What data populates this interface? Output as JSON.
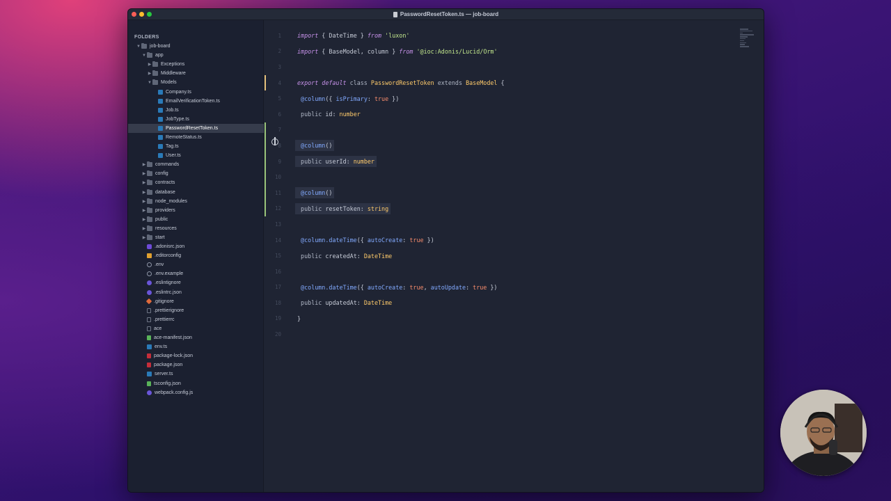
{
  "window": {
    "title": "PasswordResetToken.ts — job-board"
  },
  "sidebar": {
    "header": "FOLDERS",
    "items": [
      {
        "label": "job-board",
        "depth": 0,
        "kind": "folder",
        "open": true
      },
      {
        "label": "app",
        "depth": 1,
        "kind": "folder",
        "open": true
      },
      {
        "label": "Exceptions",
        "depth": 2,
        "kind": "folder",
        "open": false
      },
      {
        "label": "Middleware",
        "depth": 2,
        "kind": "folder",
        "open": false
      },
      {
        "label": "Models",
        "depth": 2,
        "kind": "folder",
        "open": true
      },
      {
        "label": "Company.ts",
        "depth": 3,
        "kind": "ts"
      },
      {
        "label": "EmailVerificationToken.ts",
        "depth": 3,
        "kind": "ts"
      },
      {
        "label": "Job.ts",
        "depth": 3,
        "kind": "ts"
      },
      {
        "label": "JobType.ts",
        "depth": 3,
        "kind": "ts"
      },
      {
        "label": "PasswordResetToken.ts",
        "depth": 3,
        "kind": "ts",
        "selected": true
      },
      {
        "label": "RemoteStatus.ts",
        "depth": 3,
        "kind": "ts"
      },
      {
        "label": "Tag.ts",
        "depth": 3,
        "kind": "ts"
      },
      {
        "label": "User.ts",
        "depth": 3,
        "kind": "ts"
      },
      {
        "label": "commands",
        "depth": 1,
        "kind": "folder",
        "open": false
      },
      {
        "label": "config",
        "depth": 1,
        "kind": "folder",
        "open": false
      },
      {
        "label": "contracts",
        "depth": 1,
        "kind": "folder",
        "open": false
      },
      {
        "label": "database",
        "depth": 1,
        "kind": "folder",
        "open": false
      },
      {
        "label": "node_modules",
        "depth": 1,
        "kind": "folder",
        "open": false
      },
      {
        "label": "providers",
        "depth": 1,
        "kind": "folder",
        "open": false
      },
      {
        "label": "public",
        "depth": 1,
        "kind": "folder",
        "open": false
      },
      {
        "label": "resources",
        "depth": 1,
        "kind": "folder",
        "open": false
      },
      {
        "label": "start",
        "depth": 1,
        "kind": "folder",
        "open": false
      },
      {
        "label": ".adonisrc.json",
        "depth": 1,
        "kind": "adonis"
      },
      {
        "label": ".editorconfig",
        "depth": 1,
        "kind": "edcfg"
      },
      {
        "label": ".env",
        "depth": 1,
        "kind": "gear"
      },
      {
        "label": ".env.example",
        "depth": 1,
        "kind": "gear"
      },
      {
        "label": ".eslintignore",
        "depth": 1,
        "kind": "purple"
      },
      {
        "label": ".eslintrc.json",
        "depth": 1,
        "kind": "purple"
      },
      {
        "label": ".gitignore",
        "depth": 1,
        "kind": "orange"
      },
      {
        "label": ".prettierignore",
        "depth": 1,
        "kind": "blank"
      },
      {
        "label": ".prettierrc",
        "depth": 1,
        "kind": "blank"
      },
      {
        "label": "ace",
        "depth": 1,
        "kind": "blank"
      },
      {
        "label": "ace-manifest.json",
        "depth": 1,
        "kind": "json-g"
      },
      {
        "label": "env.ts",
        "depth": 1,
        "kind": "ts"
      },
      {
        "label": "package-lock.json",
        "depth": 1,
        "kind": "npm"
      },
      {
        "label": "package.json",
        "depth": 1,
        "kind": "npm"
      },
      {
        "label": "server.ts",
        "depth": 1,
        "kind": "ts"
      },
      {
        "label": "tsconfig.json",
        "depth": 1,
        "kind": "json-g"
      },
      {
        "label": "webpack.config.js",
        "depth": 1,
        "kind": "purple"
      }
    ]
  },
  "editor": {
    "lines": [
      {
        "n": "1",
        "mark": "",
        "hl": false,
        "tokens": [
          [
            "kw",
            "import"
          ],
          [
            "plain",
            " { "
          ],
          [
            "plain",
            "DateTime"
          ],
          [
            "plain",
            " } "
          ],
          [
            "kw",
            "from"
          ],
          [
            "plain",
            " "
          ],
          [
            "str",
            "'luxon'"
          ]
        ]
      },
      {
        "n": "2",
        "mark": "",
        "hl": false,
        "tokens": [
          [
            "kw",
            "import"
          ],
          [
            "plain",
            " { "
          ],
          [
            "plain",
            "BaseModel"
          ],
          [
            "plain",
            ", "
          ],
          [
            "plain",
            "column"
          ],
          [
            "plain",
            " } "
          ],
          [
            "kw",
            "from"
          ],
          [
            "plain",
            " "
          ],
          [
            "str",
            "'@ioc:Adonis/Lucid/Orm'"
          ]
        ]
      },
      {
        "n": "3",
        "mark": "",
        "hl": false,
        "tokens": []
      },
      {
        "n": "4",
        "mark": "mod",
        "hl": false,
        "tokens": [
          [
            "kw",
            "export default"
          ],
          [
            "plain",
            " "
          ],
          [
            "mod",
            "class"
          ],
          [
            "plain",
            " "
          ],
          [
            "cls",
            "PasswordResetToken"
          ],
          [
            "plain",
            " "
          ],
          [
            "mod",
            "extends"
          ],
          [
            "plain",
            " "
          ],
          [
            "cls",
            "BaseModel"
          ],
          [
            "plain",
            " {"
          ]
        ]
      },
      {
        "n": "5",
        "mark": "",
        "hl": false,
        "tokens": [
          [
            "plain",
            " "
          ],
          [
            "dec",
            "@column"
          ],
          [
            "plain",
            "({ "
          ],
          [
            "prop",
            "isPrimary"
          ],
          [
            "plain",
            ": "
          ],
          [
            "bool",
            "true"
          ],
          [
            "plain",
            " })"
          ]
        ]
      },
      {
        "n": "6",
        "mark": "",
        "hl": false,
        "tokens": [
          [
            "plain",
            " "
          ],
          [
            "mod",
            "public"
          ],
          [
            "plain",
            " "
          ],
          [
            "plain",
            "id"
          ],
          [
            "plain",
            ": "
          ],
          [
            "type",
            "number"
          ]
        ]
      },
      {
        "n": "7",
        "mark": "add",
        "hl": false,
        "tokens": []
      },
      {
        "n": "8",
        "mark": "add",
        "hl": true,
        "caret": true,
        "tokens": [
          [
            "plain",
            " "
          ],
          [
            "dec",
            "@column"
          ],
          [
            "plain",
            "()"
          ]
        ]
      },
      {
        "n": "9",
        "mark": "add",
        "hl": true,
        "tokens": [
          [
            "plain",
            " "
          ],
          [
            "mod",
            "public"
          ],
          [
            "plain",
            " "
          ],
          [
            "plain",
            "userId"
          ],
          [
            "plain",
            ": "
          ],
          [
            "type",
            "number"
          ]
        ]
      },
      {
        "n": "10",
        "mark": "add",
        "hl": true,
        "tokens": []
      },
      {
        "n": "11",
        "mark": "add",
        "hl": true,
        "tokens": [
          [
            "plain",
            " "
          ],
          [
            "dec",
            "@column"
          ],
          [
            "plain",
            "()"
          ]
        ]
      },
      {
        "n": "12",
        "mark": "add",
        "hl": true,
        "tokens": [
          [
            "plain",
            " "
          ],
          [
            "mod",
            "public"
          ],
          [
            "plain",
            " "
          ],
          [
            "plain",
            "resetToken"
          ],
          [
            "plain",
            ": "
          ],
          [
            "type",
            "string"
          ]
        ]
      },
      {
        "n": "13",
        "mark": "",
        "hl": false,
        "tokens": []
      },
      {
        "n": "14",
        "mark": "",
        "hl": false,
        "tokens": [
          [
            "plain",
            " "
          ],
          [
            "dec",
            "@column.dateTime"
          ],
          [
            "plain",
            "({ "
          ],
          [
            "prop",
            "autoCreate"
          ],
          [
            "plain",
            ": "
          ],
          [
            "bool",
            "true"
          ],
          [
            "plain",
            " })"
          ]
        ]
      },
      {
        "n": "15",
        "mark": "",
        "hl": false,
        "tokens": [
          [
            "plain",
            " "
          ],
          [
            "mod",
            "public"
          ],
          [
            "plain",
            " "
          ],
          [
            "plain",
            "createdAt"
          ],
          [
            "plain",
            ": "
          ],
          [
            "type",
            "DateTime"
          ]
        ]
      },
      {
        "n": "16",
        "mark": "",
        "hl": false,
        "tokens": []
      },
      {
        "n": "17",
        "mark": "",
        "hl": false,
        "tokens": [
          [
            "plain",
            " "
          ],
          [
            "dec",
            "@column.dateTime"
          ],
          [
            "plain",
            "({ "
          ],
          [
            "prop",
            "autoCreate"
          ],
          [
            "plain",
            ": "
          ],
          [
            "bool",
            "true"
          ],
          [
            "plain",
            ", "
          ],
          [
            "prop",
            "autoUpdate"
          ],
          [
            "plain",
            ": "
          ],
          [
            "bool",
            "true"
          ],
          [
            "plain",
            " })"
          ]
        ]
      },
      {
        "n": "18",
        "mark": "",
        "hl": false,
        "tokens": [
          [
            "plain",
            " "
          ],
          [
            "mod",
            "public"
          ],
          [
            "plain",
            " "
          ],
          [
            "plain",
            "updatedAt"
          ],
          [
            "plain",
            ": "
          ],
          [
            "type",
            "DateTime"
          ]
        ]
      },
      {
        "n": "19",
        "mark": "",
        "hl": false,
        "tokens": [
          [
            "plain",
            "}"
          ]
        ]
      },
      {
        "n": "20",
        "mark": "",
        "hl": false,
        "tokens": []
      }
    ]
  },
  "icons": {
    "close": "close-dot-icon",
    "minimize": "minimize-dot-icon",
    "zoom": "zoom-dot-icon",
    "file": "file-icon",
    "cursor": "text-cursor-icon"
  }
}
